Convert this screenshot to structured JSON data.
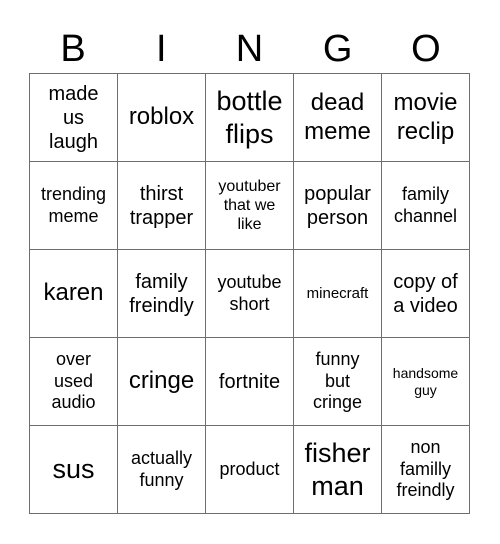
{
  "header": {
    "letters": [
      "B",
      "I",
      "N",
      "G",
      "O"
    ]
  },
  "card": {
    "rows": [
      [
        "made\nus\nlaugh",
        "roblox",
        "bottle\nflips",
        "dead\nmeme",
        "movie\nreclip"
      ],
      [
        "trending\nmeme",
        "thirst\ntrapper",
        "youtuber\nthat we\nlike",
        "popular\nperson",
        "family\nchannel"
      ],
      [
        "karen",
        "family\nfreindly",
        "youtube\nshort",
        "minecraft",
        "copy of\na video"
      ],
      [
        "over\nused\naudio",
        "cringe",
        "fortnite",
        "funny\nbut\ncringe",
        "handsome\nguy"
      ],
      [
        "sus",
        "actually\nfunny",
        "product",
        "fisher\nman",
        "non\nfamilly\nfreindly"
      ]
    ]
  },
  "colors": {
    "grid_line": "#6e6e6e",
    "text": "#000000",
    "background": "#ffffff"
  }
}
